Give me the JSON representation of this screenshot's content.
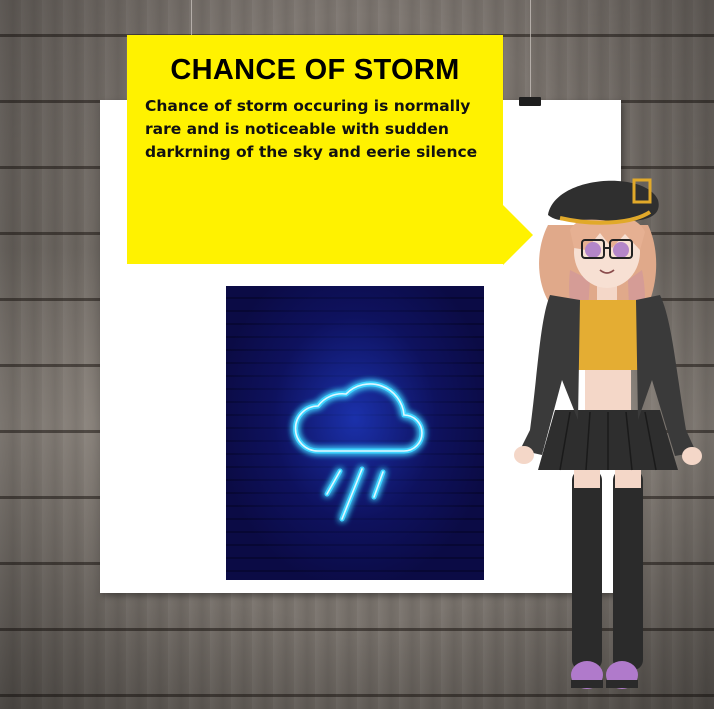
{
  "card": {
    "title": "CHANCE OF STORM",
    "body": "Chance of storm occuring is normally rare and is noticeable with sudden darkrning of the sky and eerie silence"
  },
  "illustration": {
    "icon": "neon-rain-cloud-icon",
    "colors": {
      "glow": "#3fd4ff",
      "background": "#0b0b45"
    }
  },
  "colors": {
    "bubble": "#fff200",
    "paper": "#ffffff",
    "wood": "#7a736d"
  }
}
